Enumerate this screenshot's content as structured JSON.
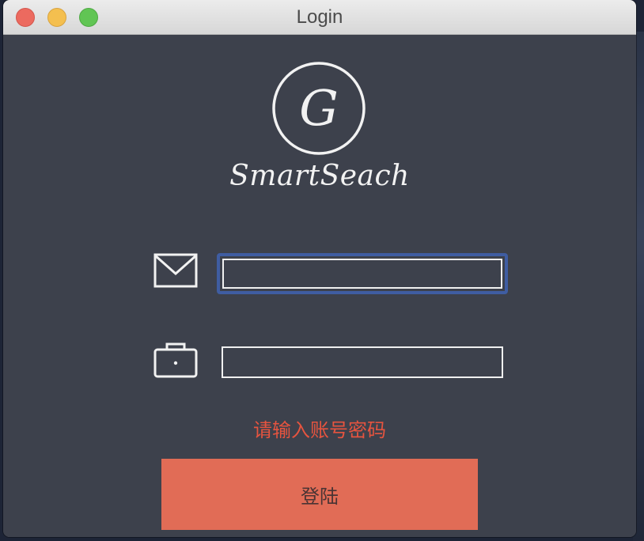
{
  "window": {
    "title": "Login"
  },
  "brand": {
    "logo_letter": "G",
    "name": "SmartSeach"
  },
  "form": {
    "email": {
      "icon": "mail-icon",
      "value": "",
      "placeholder": ""
    },
    "password": {
      "icon": "lock-icon",
      "value": "",
      "placeholder": ""
    },
    "error_message": "请输入账号密码",
    "submit_label": "登陆"
  },
  "colors": {
    "background": "#3d414c",
    "focus_ring": "#3f5da2",
    "error": "#e6543f",
    "button": "#e16c56"
  }
}
